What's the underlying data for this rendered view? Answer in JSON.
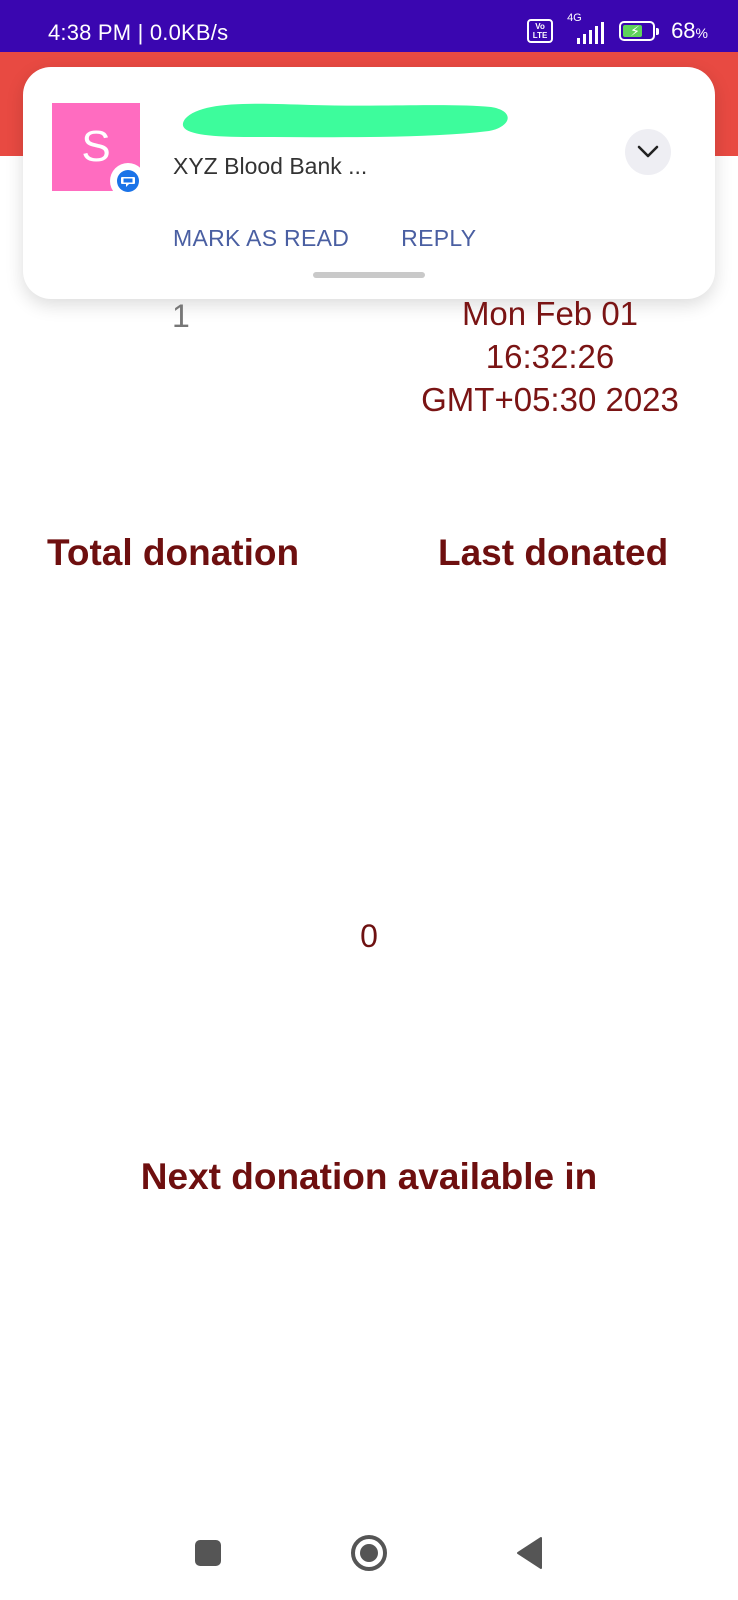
{
  "status_bar": {
    "time": "4:38 PM | 0.0KB/s",
    "volte_label": "Vo\nLTE",
    "network_label": "4G",
    "battery_percent": "68",
    "battery_percent_sign": "%",
    "battery_level": 0.68,
    "color": "#3a06b0"
  },
  "app_bar": {
    "color": "#e84a42"
  },
  "notification": {
    "avatar_letter": "S",
    "avatar_color": "#ff6cc0",
    "app_icon": "messages-icon",
    "sender_redacted": true,
    "redaction_color": "#3dfc9c",
    "preview_text": "XYZ Blood Bank ...",
    "expand_icon": "chevron-down-icon",
    "actions": {
      "mark_as_read": "MARK AS READ",
      "reply": "REPLY"
    }
  },
  "donation": {
    "total_value": "1",
    "last_donated_value": "Mon Feb 01 16:32:26 GMT+05:30 2023",
    "total_label": "Total donation",
    "last_label": "Last donated",
    "next_value": "0",
    "next_label": "Next donation available in"
  },
  "nav_bar": {
    "recents_icon": "square-icon",
    "home_icon": "circle-icon",
    "back_icon": "back-triangle-icon"
  }
}
